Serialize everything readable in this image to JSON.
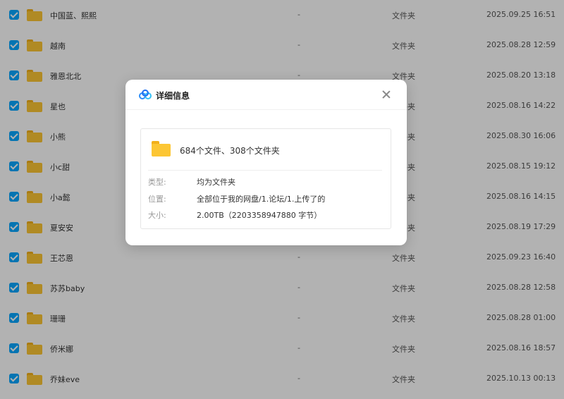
{
  "files": [
    {
      "name": "中国蓝、熙熙",
      "size": "-",
      "type": "文件夹",
      "date": "2025.09.25 16:51"
    },
    {
      "name": "越南",
      "size": "-",
      "type": "文件夹",
      "date": "2025.08.28 12:59"
    },
    {
      "name": "雅恩北北",
      "size": "-",
      "type": "文件夹",
      "date": "2025.08.20 13:18"
    },
    {
      "name": "星也",
      "size": "-",
      "type": "文件夹",
      "date": "2025.08.16 14:22"
    },
    {
      "name": "小熊",
      "size": "-",
      "type": "文件夹",
      "date": "2025.08.30 16:06"
    },
    {
      "name": "小c甜",
      "size": "-",
      "type": "文件夹",
      "date": "2025.08.15 19:12"
    },
    {
      "name": "小a懿",
      "size": "-",
      "type": "文件夹",
      "date": "2025.08.16 14:15"
    },
    {
      "name": "夏安安",
      "size": "-",
      "type": "文件夹",
      "date": "2025.08.19 17:29"
    },
    {
      "name": "王芯恩",
      "size": "-",
      "type": "文件夹",
      "date": "2025.09.23 16:40"
    },
    {
      "name": "苏苏baby",
      "size": "-",
      "type": "文件夹",
      "date": "2025.08.28 12:58"
    },
    {
      "name": "珊珊",
      "size": "-",
      "type": "文件夹",
      "date": "2025.08.28 01:00"
    },
    {
      "name": "侨米娜",
      "size": "-",
      "type": "文件夹",
      "date": "2025.08.16 18:57"
    },
    {
      "name": "乔妹eve",
      "size": "-",
      "type": "文件夹",
      "date": "2025.10.13 00:13"
    }
  ],
  "modal": {
    "title": "详细信息",
    "summary": "684个文件、308个文件夹",
    "type_label": "类型:",
    "type_value": "均为文件夹",
    "location_label": "位置:",
    "location_value": "全部位于我的网盘/1.论坛/1.上传了的",
    "size_label": "大小:",
    "size_value": "2.00TB（2203358947880 字节）"
  },
  "colors": {
    "checkbox": "#06a7ff",
    "folder": "#fcc634",
    "overlay": "rgba(0,0,0,0.30)"
  },
  "icons": {
    "app_logo": "baidu-netdisk-logo-icon",
    "close": "close-icon",
    "folder": "folder-icon"
  }
}
